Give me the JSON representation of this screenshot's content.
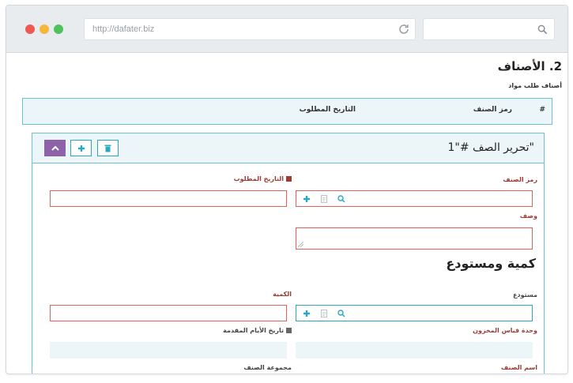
{
  "browser": {
    "url": "http://dafater.biz",
    "search_value": ""
  },
  "page": {
    "section_title": "2. الأصناف",
    "subtitle": "أصناف طلب مواد"
  },
  "items_table": {
    "headers": [
      "#",
      "رمز الصنف",
      "التاريخ المطلوب"
    ]
  },
  "editor": {
    "title": "\"تحرير الصف #\"1",
    "labels": {
      "item_code": "رمز الصنف",
      "required_date": "التاريخ المطلوب",
      "description": "وصف",
      "warehouse": "مستودع",
      "quantity": "الكمية",
      "stock_uom": "وحدة قياس المخزون",
      "lead_time_date": "تاريخ الأيام المقدمة",
      "item_name": "اسم الصنف",
      "item_group": "مجموعة الصنف"
    },
    "group_title": "كمية ومستودع",
    "values": {
      "item_code": "",
      "required_date": "",
      "description": "",
      "warehouse": "",
      "quantity": "",
      "stock_uom": "",
      "lead_time_date": ""
    }
  },
  "colors": {
    "accent": "#2aa7c1",
    "required": "#d9645c",
    "collapse_button": "#8e62a8",
    "panel_bg": "#ecf6f8"
  },
  "icons": [
    "reload-icon",
    "search-icon",
    "chevron-up-icon",
    "plus-icon",
    "trash-icon",
    "document-icon"
  ]
}
